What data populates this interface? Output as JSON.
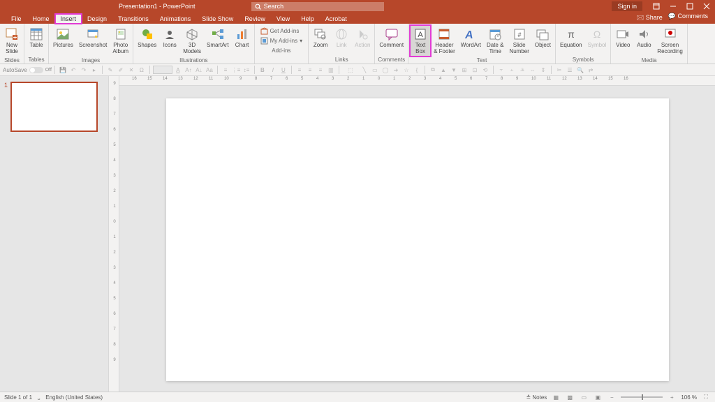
{
  "title": "Presentation1 - PowerPoint",
  "search_placeholder": "Search",
  "signin": "Sign in",
  "tabs": [
    "File",
    "Home",
    "Insert",
    "Design",
    "Transitions",
    "Animations",
    "Slide Show",
    "Review",
    "View",
    "Help",
    "Acrobat"
  ],
  "active_tab": "Insert",
  "highlighted_tab": "Insert",
  "share": "Share",
  "comments_btn": "Comments",
  "ribbon": {
    "slides": {
      "label": "Slides",
      "new_slide": "New\nSlide"
    },
    "tables": {
      "label": "Tables",
      "table": "Table"
    },
    "images": {
      "label": "Images",
      "pictures": "Pictures",
      "screenshot": "Screenshot",
      "photo_album": "Photo\nAlbum"
    },
    "illustrations": {
      "label": "Illustrations",
      "shapes": "Shapes",
      "icons": "Icons",
      "models": "3D\nModels",
      "smartart": "SmartArt",
      "chart": "Chart"
    },
    "addins": {
      "label": "Add-ins",
      "get": "Get Add-ins",
      "my": "My Add-ins"
    },
    "links": {
      "label": "Links",
      "zoom": "Zoom",
      "link": "Link",
      "action": "Action"
    },
    "comments_grp": {
      "label": "Comments",
      "comment": "Comment"
    },
    "text": {
      "label": "Text",
      "textbox": "Text\nBox",
      "header": "Header\n& Footer",
      "wordart": "WordArt",
      "datetime": "Date &\nTime",
      "slidenum": "Slide\nNumber",
      "object": "Object"
    },
    "symbols": {
      "label": "Symbols",
      "equation": "Equation",
      "symbol": "Symbol"
    },
    "media": {
      "label": "Media",
      "video": "Video",
      "audio": "Audio",
      "screenrec": "Screen\nRecording"
    }
  },
  "autosave_label": "AutoSave",
  "autosave_state": "Off",
  "thumb_number": "1",
  "ruler_h_marks": [
    "16",
    "15",
    "14",
    "13",
    "12",
    "11",
    "10",
    "9",
    "8",
    "7",
    "6",
    "5",
    "4",
    "3",
    "2",
    "1",
    "0",
    "1",
    "2",
    "3",
    "4",
    "5",
    "6",
    "7",
    "8",
    "9",
    "10",
    "11",
    "12",
    "13",
    "14",
    "15",
    "16"
  ],
  "ruler_v_marks": [
    "9",
    "8",
    "7",
    "6",
    "5",
    "4",
    "3",
    "2",
    "1",
    "0",
    "1",
    "2",
    "3",
    "4",
    "5",
    "6",
    "7",
    "8",
    "9"
  ],
  "status": {
    "slide": "Slide 1 of 1",
    "lang": "English (United States)",
    "notes": "Notes",
    "zoom": "106 %"
  }
}
